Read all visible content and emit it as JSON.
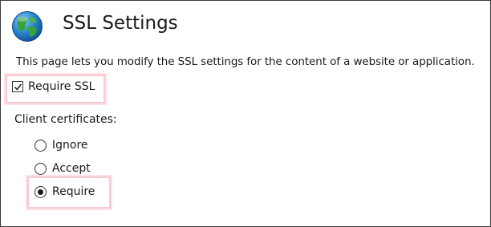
{
  "header": {
    "title": "SSL Settings",
    "icon": "globe-icon"
  },
  "description": "This page lets you modify the SSL settings for the content of a website or application.",
  "require_ssl": {
    "label": "Require SSL",
    "checked": true
  },
  "client_certificates": {
    "label": "Client certificates:",
    "options": [
      {
        "label": "Ignore",
        "selected": false
      },
      {
        "label": "Accept",
        "selected": false
      },
      {
        "label": "Require",
        "selected": true
      }
    ]
  },
  "colors": {
    "highlight_border": "#f6c9cf",
    "frame_border": "#3a3a3a"
  }
}
